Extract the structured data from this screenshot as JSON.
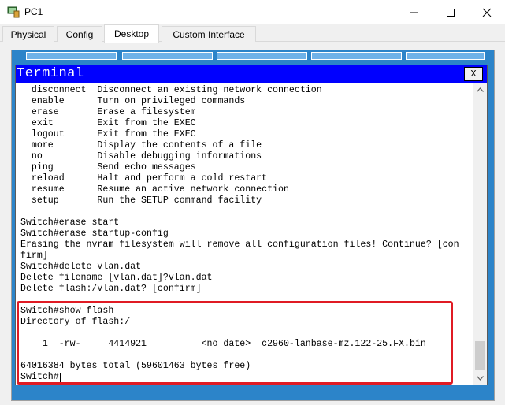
{
  "window": {
    "title": "PC1",
    "icons": {
      "app": "pc-icon",
      "minimize": "minimize-icon",
      "maximize": "maximize-icon",
      "close": "close-icon"
    }
  },
  "tabs": [
    {
      "label": "Physical",
      "active": false
    },
    {
      "label": "Config",
      "active": false
    },
    {
      "label": "Desktop",
      "active": true
    },
    {
      "label": "Custom Interface",
      "active": false
    }
  ],
  "terminal": {
    "title": "Terminal",
    "close_label": "X",
    "lines": [
      "  disconnect  Disconnect an existing network connection",
      "  enable      Turn on privileged commands",
      "  erase       Erase a filesystem",
      "  exit        Exit from the EXEC",
      "  logout      Exit from the EXEC",
      "  more        Display the contents of a file",
      "  no          Disable debugging informations",
      "  ping        Send echo messages",
      "  reload      Halt and perform a cold restart",
      "  resume      Resume an active network connection",
      "  setup       Run the SETUP command facility",
      "",
      "Switch#erase start",
      "Switch#erase startup-config",
      "Erasing the nvram filesystem will remove all configuration files! Continue? [con",
      "firm]",
      "Switch#delete vlan.dat",
      "Delete filename [vlan.dat]?vlan.dat",
      "Delete flash:/vlan.dat? [confirm]",
      "",
      "Switch#show flash",
      "Directory of flash:/",
      "",
      "    1  -rw-     4414921          <no date>  c2960-lanbase-mz.122-25.FX.bin",
      "",
      "64016384 bytes total (59601463 bytes free)",
      "Switch#"
    ]
  },
  "colors": {
    "terminal_header": "#0000ff",
    "desktop_bg": "#2c84c9",
    "highlight": "#e01b24"
  }
}
